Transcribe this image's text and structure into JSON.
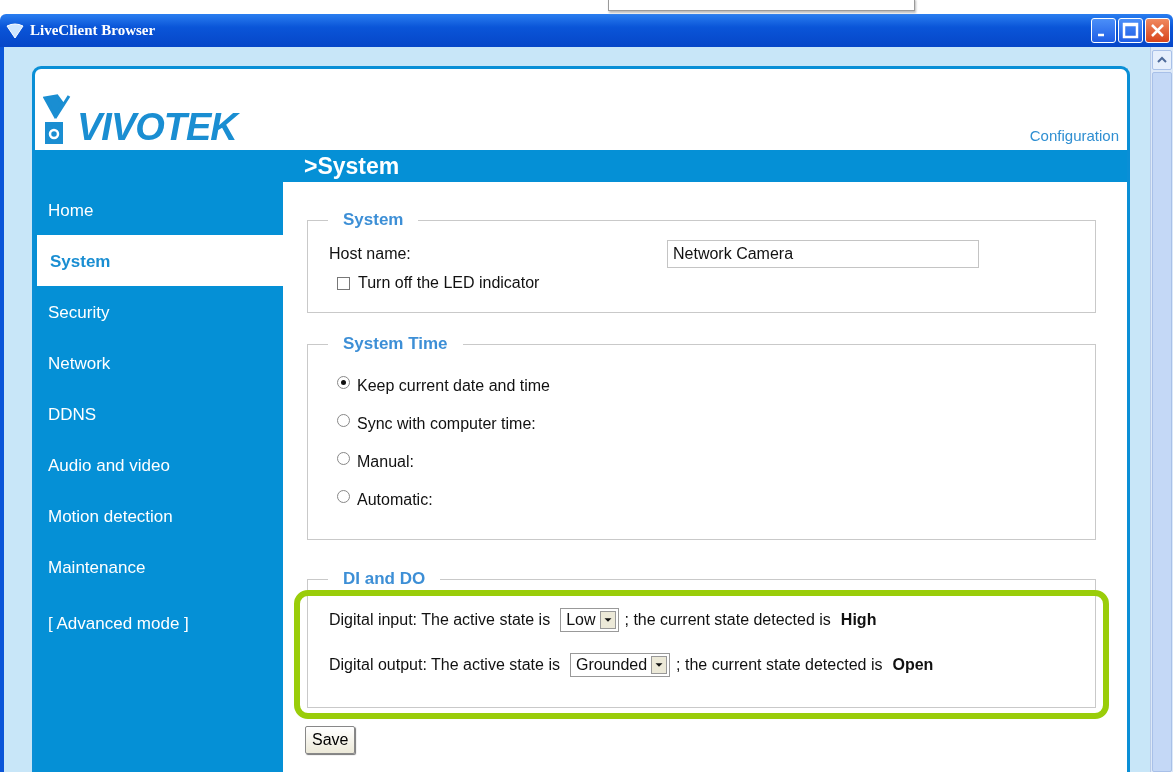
{
  "window": {
    "title": "LiveClient Browser"
  },
  "header": {
    "logo": "VIVOTEK",
    "link": "Configuration",
    "page_title": ">System"
  },
  "sidebar": {
    "items": [
      {
        "label": "Home",
        "selected": false
      },
      {
        "label": "System",
        "selected": true
      },
      {
        "label": "Security",
        "selected": false
      },
      {
        "label": "Network",
        "selected": false
      },
      {
        "label": "DDNS",
        "selected": false
      },
      {
        "label": "Audio and video",
        "selected": false
      },
      {
        "label": "Motion detection",
        "selected": false
      },
      {
        "label": "Maintenance",
        "selected": false
      }
    ],
    "advanced": "[ Advanced mode ]"
  },
  "system": {
    "legend": "System",
    "host_label": "Host name:",
    "host_value": "Network Camera",
    "led": {
      "label": "Turn off the LED indicator",
      "checked": false
    }
  },
  "system_time": {
    "legend": "System Time",
    "options": [
      {
        "label": "Keep current date and time",
        "selected": true
      },
      {
        "label": "Sync with computer time:",
        "selected": false
      },
      {
        "label": "Manual:",
        "selected": false
      },
      {
        "label": "Automatic:",
        "selected": false
      }
    ]
  },
  "dido": {
    "legend": "DI and DO",
    "rows": [
      {
        "label": "Digital input: The active state is",
        "value": "Low",
        "note": "; the current state detected is",
        "state": "High"
      },
      {
        "label": "Digital output: The active state is",
        "value": "Grounded",
        "note": "; the current state detected is",
        "state": "Open"
      }
    ]
  },
  "save": "Save"
}
